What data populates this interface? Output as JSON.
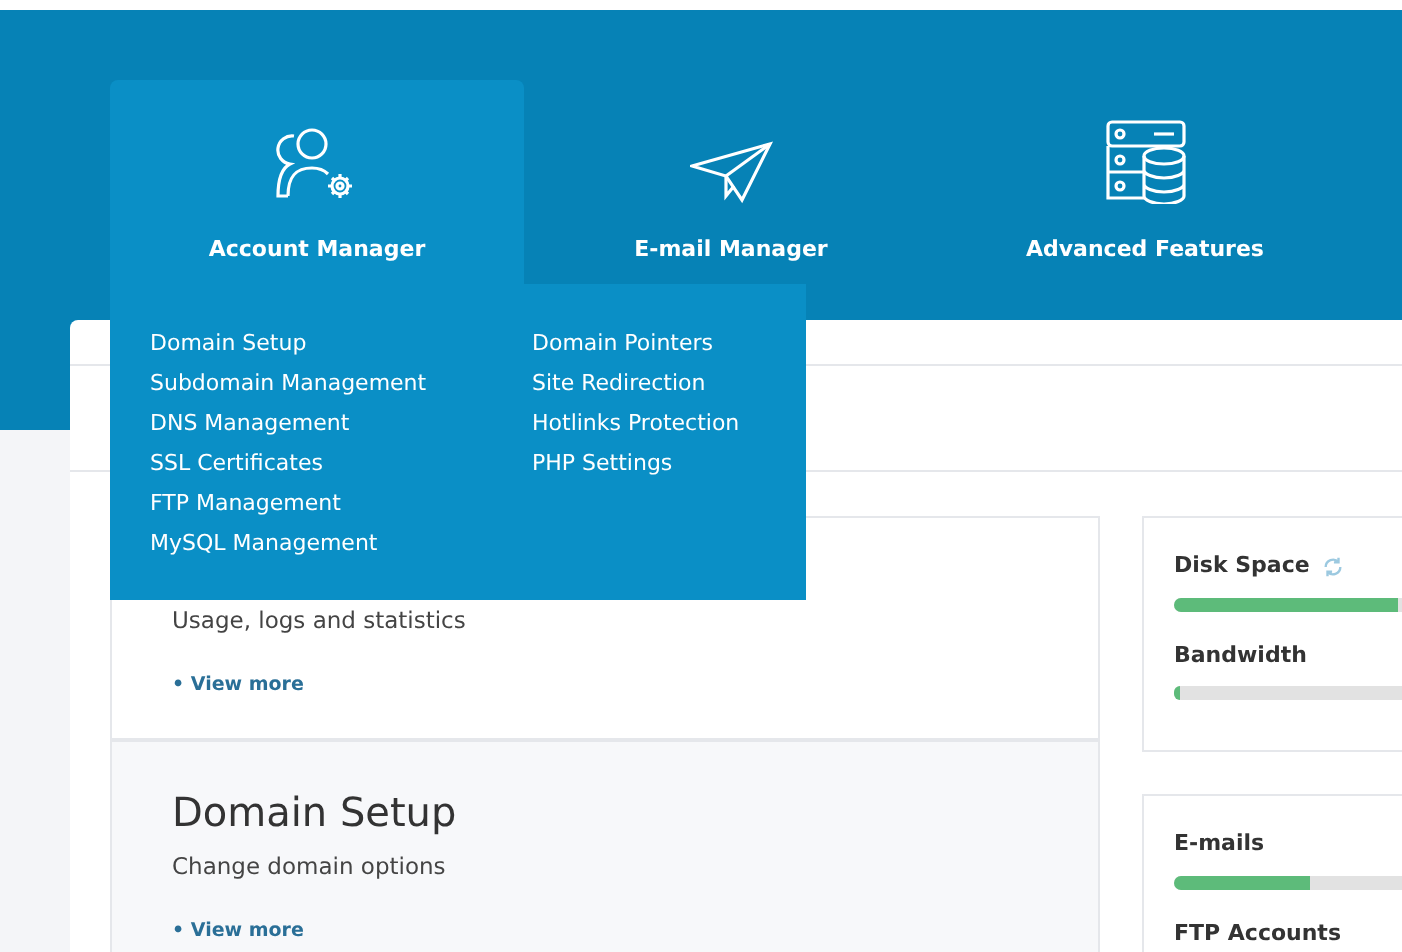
{
  "nav": [
    {
      "label": "Account Manager",
      "selected": true
    },
    {
      "label": "E-mail Manager",
      "selected": false
    },
    {
      "label": "Advanced Features",
      "selected": false
    }
  ],
  "dropdown": {
    "columns": [
      [
        "Domain Setup",
        "Subdomain Management",
        "DNS Management",
        "SSL Certificates",
        "FTP Management",
        "MySQL Management"
      ],
      [
        "Domain Pointers",
        "Site Redirection",
        "Hotlinks Protection",
        "PHP Settings"
      ]
    ]
  },
  "cards": [
    {
      "description": "Usage, logs and statistics",
      "link": "• View more",
      "shaded": false
    },
    {
      "title": "Domain Setup",
      "description": "Change domain options",
      "link": "• View more",
      "shaded": true
    }
  ],
  "stats": [
    {
      "items": [
        {
          "label": "Disk Space",
          "refresh": true,
          "level": 0.98
        },
        {
          "label": "Bandwidth",
          "refresh": false,
          "level": 0.03
        }
      ]
    },
    {
      "items": [
        {
          "label": "E-mails",
          "refresh": false,
          "level": 0.6
        },
        {
          "label": "FTP Accounts",
          "refresh": false
        }
      ]
    }
  ]
}
